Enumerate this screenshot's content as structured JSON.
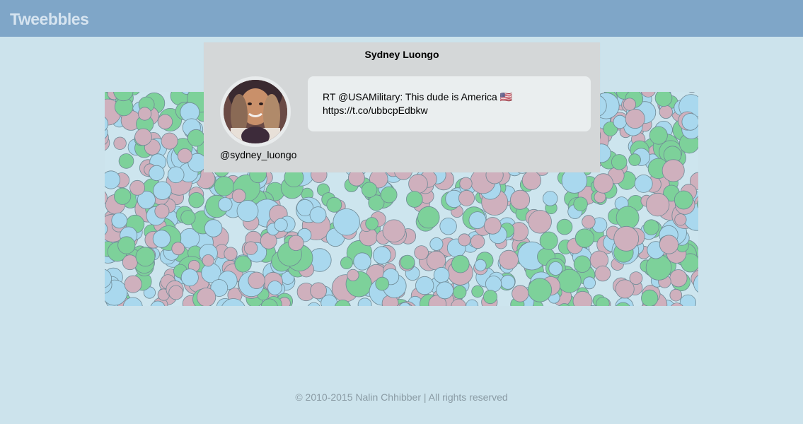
{
  "app": {
    "brand": "Tweebbles"
  },
  "tweet": {
    "user_name": "Sydney Luongo",
    "handle": "@sydney_luongo",
    "text_line1": "RT @USAMilitary: This dude is America 🇺🇸",
    "text_line2": "https://t.co/ubbcpEdbkw",
    "avatar_icon": "user-avatar-photo"
  },
  "bubbles": {
    "colors": [
      "#7dd19a",
      "#a9d8ee",
      "#cfb0bd"
    ]
  },
  "footer": {
    "text": "© 2010-2015 Nalin Chhibber | All rights reserved"
  }
}
